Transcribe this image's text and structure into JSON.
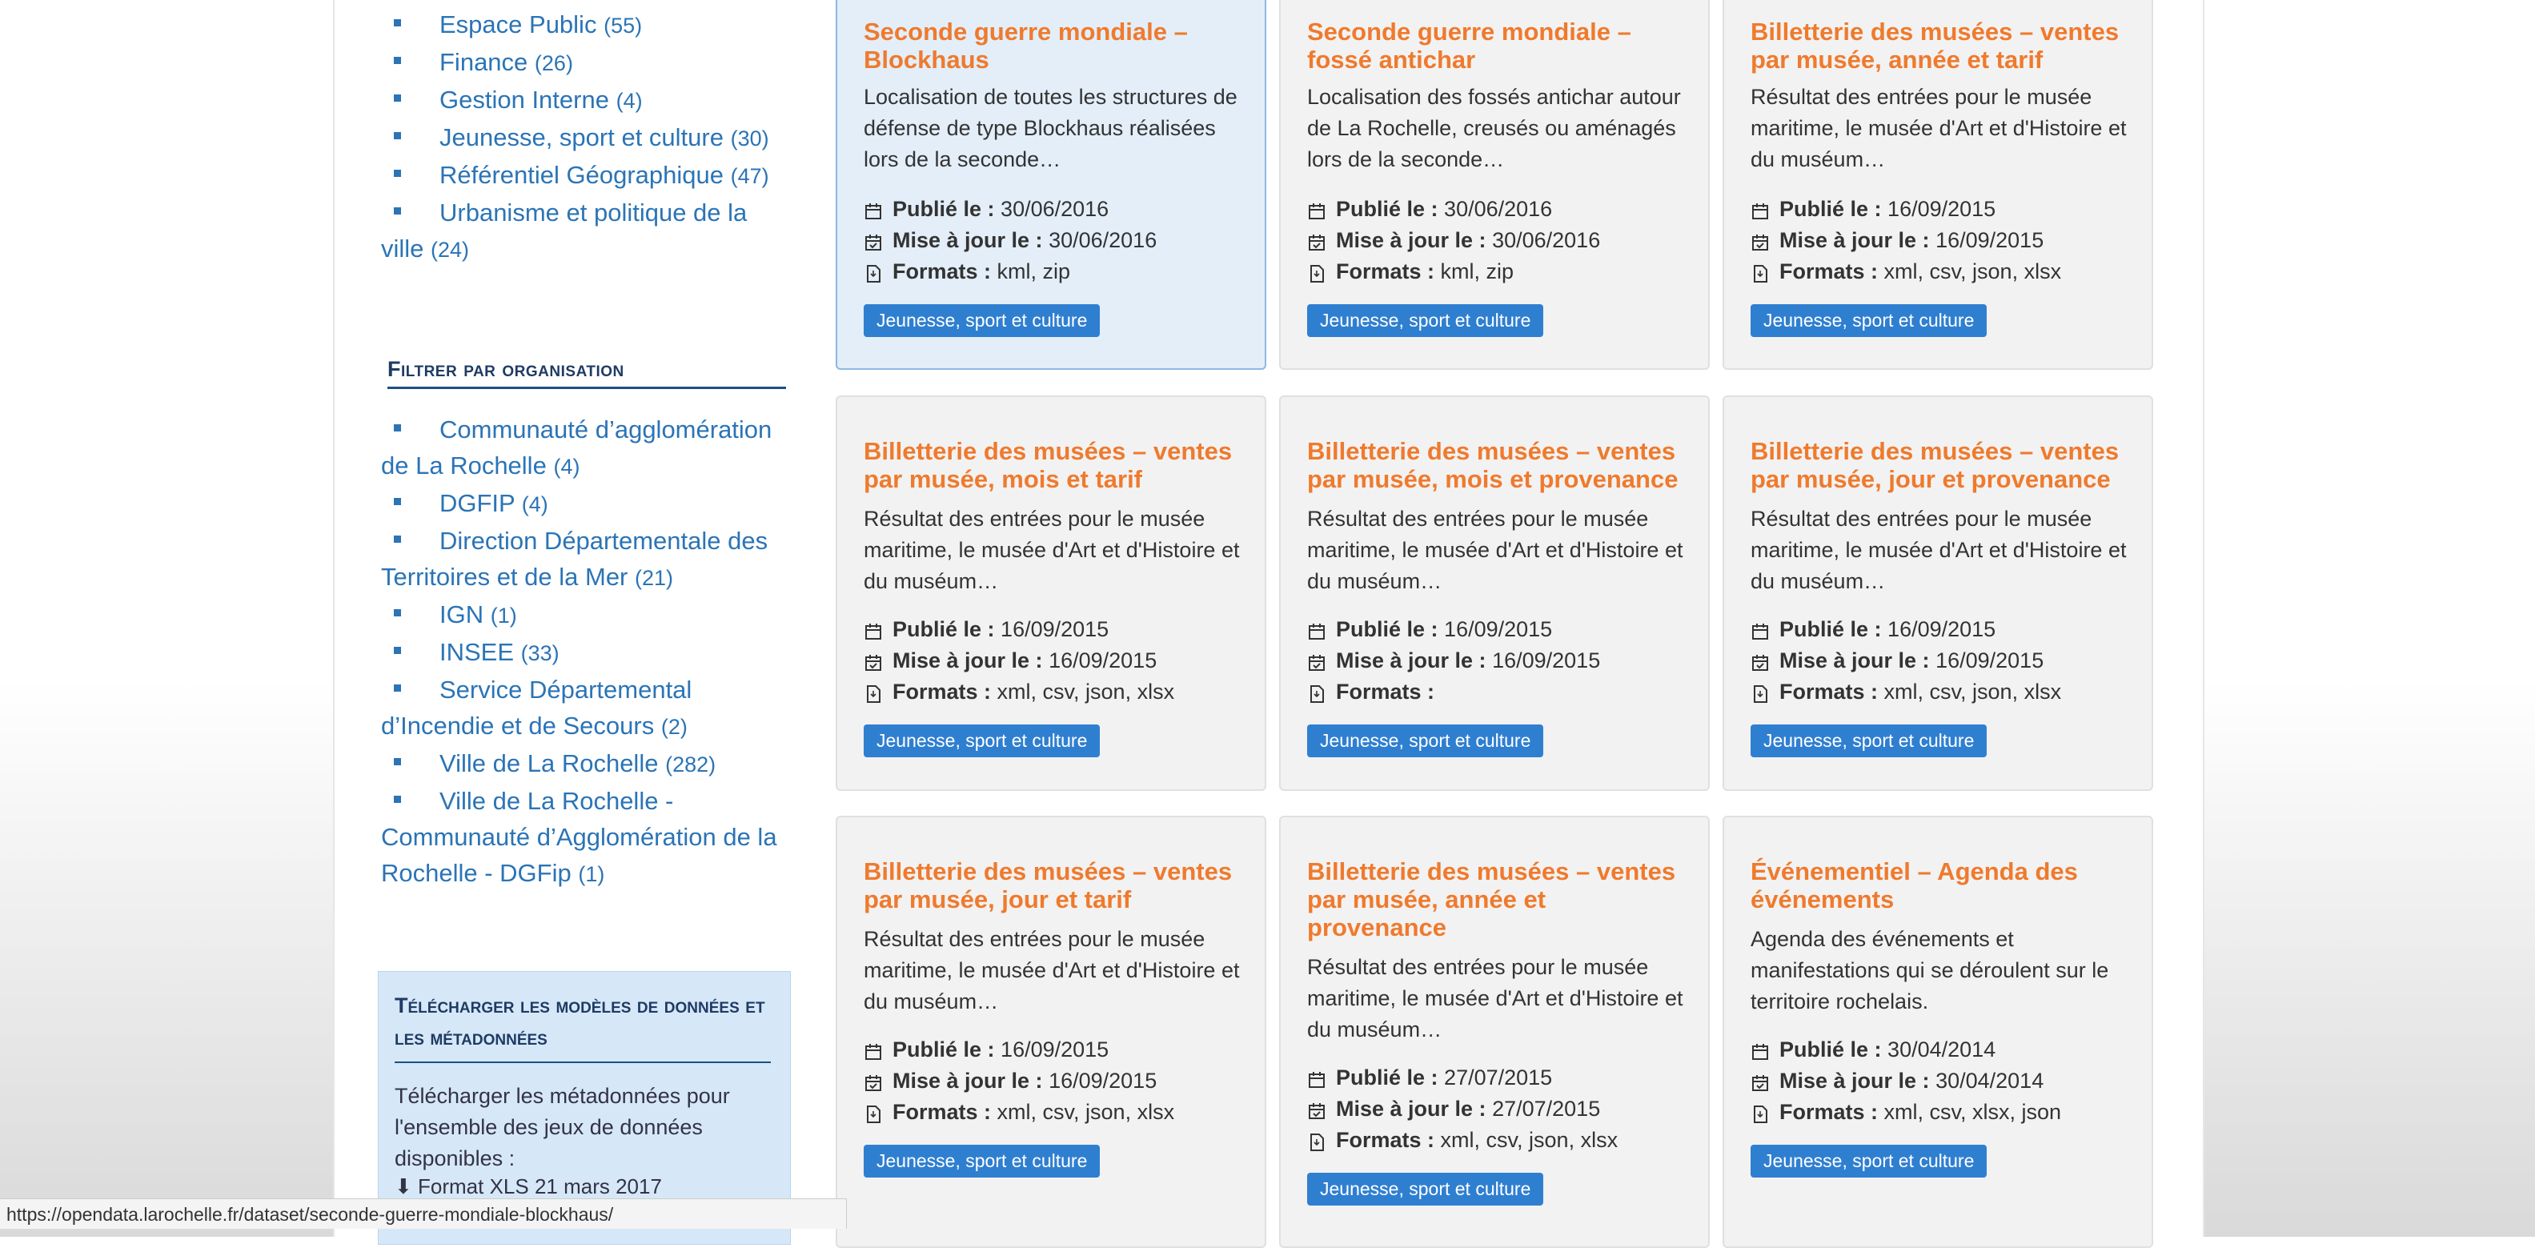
{
  "themes": [
    {
      "label": "Espace Public",
      "count": "(55)"
    },
    {
      "label": "Finance",
      "count": "(26)"
    },
    {
      "label": "Gestion Interne",
      "count": "(4)"
    },
    {
      "label": "Jeunesse, sport et culture",
      "count": "(30)"
    },
    {
      "label": "Référentiel Géographique",
      "count": "(47)"
    },
    {
      "label": "Urbanisme et politique de la ville",
      "count": "(24)"
    }
  ],
  "filter_org": {
    "heading": "Filtrer par organisation",
    "items": [
      {
        "label": "Communauté d’agglomération de La Rochelle",
        "count": "(4)"
      },
      {
        "label": "DGFIP",
        "count": "(4)"
      },
      {
        "label": "Direction Départementale des Territoires et de la Mer",
        "count": "(21)"
      },
      {
        "label": "IGN",
        "count": "(1)"
      },
      {
        "label": "INSEE",
        "count": "(33)"
      },
      {
        "label": "Service Départemental d’Incendie et de Secours",
        "count": "(2)"
      },
      {
        "label": "Ville de La Rochelle",
        "count": "(282)"
      },
      {
        "label": "Ville de La Rochelle - Communauté d’Agglomération de la Rochelle - DGFip",
        "count": "(1)"
      }
    ]
  },
  "download": {
    "title": "Télécharger les modèles de données et les métadonnées",
    "text": "Télécharger les métadonnées pour l'ensemble des jeux de données disponibles :",
    "link": "Format XLS 21 mars 2017"
  },
  "labels": {
    "published": "Publié le :",
    "updated": "Mise à jour le :",
    "formats": "Formats :"
  },
  "cards": [
    {
      "title": "Seconde guerre mondiale – Blockhaus",
      "desc": "Localisation de toutes les structures de défense de type Blockhaus réalisées lors de la seconde…",
      "published": "30/06/2016",
      "updated": "30/06/2016",
      "formats": "kml, zip",
      "tag": "Jeunesse, sport et culture"
    },
    {
      "title": "Seconde guerre mondiale – fossé antichar",
      "desc": "Localisation des fossés antichar autour de La Rochelle, creusés ou aménagés lors de la seconde…",
      "published": "30/06/2016",
      "updated": "30/06/2016",
      "formats": "kml, zip",
      "tag": "Jeunesse, sport et culture"
    },
    {
      "title": "Billetterie des musées – ventes par musée, année et tarif",
      "desc": "Résultat des entrées pour le musée maritime, le musée d'Art et d'Histoire et du muséum…",
      "published": "16/09/2015",
      "updated": "16/09/2015",
      "formats": "xml, csv, json, xlsx",
      "tag": "Jeunesse, sport et culture"
    },
    {
      "title": "Billetterie des musées – ventes par musée, mois et tarif",
      "desc": "Résultat des entrées pour le musée maritime, le musée d'Art et d'Histoire et du muséum…",
      "published": "16/09/2015",
      "updated": "16/09/2015",
      "formats": "xml, csv, json, xlsx",
      "tag": "Jeunesse, sport et culture"
    },
    {
      "title": "Billetterie des musées – ventes par musée, mois et provenance",
      "desc": "Résultat des entrées pour le musée maritime, le musée d'Art et d'Histoire et du muséum…",
      "published": "16/09/2015",
      "updated": "16/09/2015",
      "formats": "",
      "tag": "Jeunesse, sport et culture"
    },
    {
      "title": "Billetterie des musées – ventes par musée, jour et provenance",
      "desc": "Résultat des entrées pour le musée maritime, le musée d'Art et d'Histoire et du muséum…",
      "published": "16/09/2015",
      "updated": "16/09/2015",
      "formats": "xml, csv, json, xlsx",
      "tag": "Jeunesse, sport et culture"
    },
    {
      "title": "Billetterie des musées – ventes par musée, jour et tarif",
      "desc": "Résultat des entrées pour le musée maritime, le musée d'Art et d'Histoire et du muséum…",
      "published": "16/09/2015",
      "updated": "16/09/2015",
      "formats": "xml, csv, json, xlsx",
      "tag": "Jeunesse, sport et culture"
    },
    {
      "title": "Billetterie des musées – ventes par musée, année et provenance",
      "desc": "Résultat des entrées pour le musée maritime, le musée d'Art et d'Histoire et du muséum…",
      "published": "27/07/2015",
      "updated": "27/07/2015",
      "formats": "xml, csv, json, xlsx",
      "tag": "Jeunesse, sport et culture"
    },
    {
      "title": "Événementiel – Agenda des événements",
      "desc": "Agenda des événements et manifestations qui se déroulent sur le territoire rochelais.",
      "published": "30/04/2014",
      "updated": "30/04/2014",
      "formats": "xml, csv, xlsx, json",
      "tag": "Jeunesse, sport et culture"
    }
  ],
  "status_url": "https://opendata.larochelle.fr/dataset/seconde-guerre-mondiale-blockhaus/",
  "colors": {
    "accent": "#ef7a2d",
    "link": "#2b74b6",
    "tag": "#2f7fd1"
  }
}
